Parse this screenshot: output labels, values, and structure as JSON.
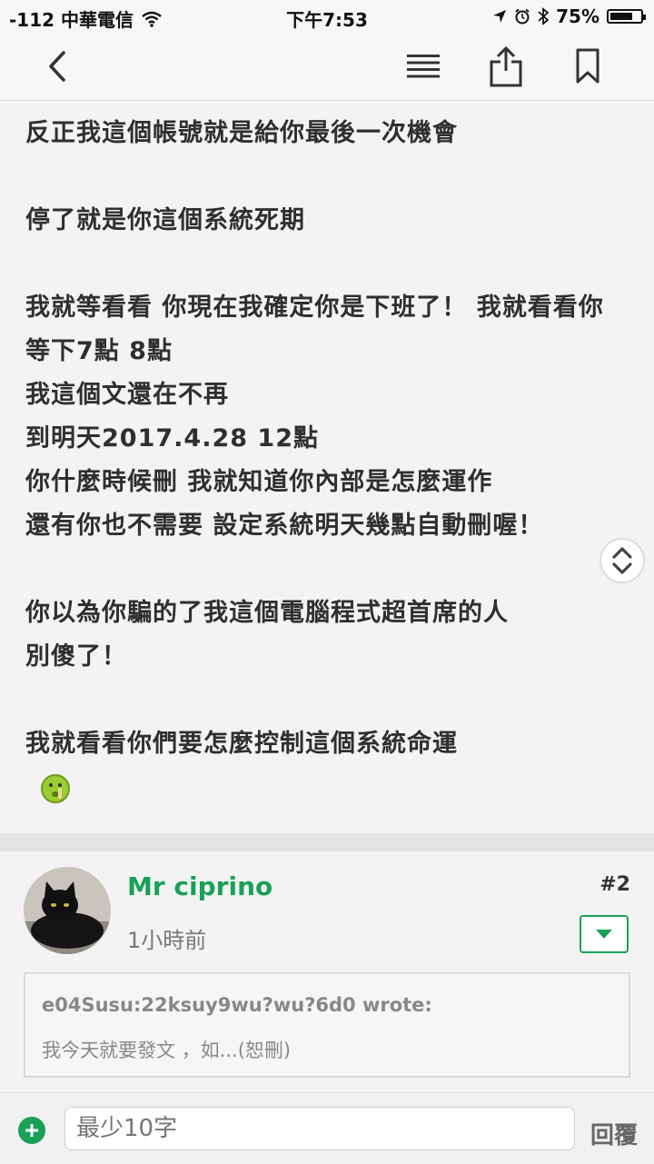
{
  "status_bar": {
    "carrier": "-112 中華電信",
    "time": "下午7:53",
    "battery": "75%",
    "battery_level": 0.75
  },
  "nav": {
    "back_icon": "chevron-left-icon",
    "menu_icon": "hamburger-menu-icon",
    "share_icon": "share-icon",
    "bookmark_icon": "bookmark-icon"
  },
  "post": {
    "lines": [
      "反正我這個帳號就是給你最後一次機會",
      "",
      "停了就是你這個系統死期",
      "",
      "我就等看看 你現在我確定你是下班了！ 我就看看你",
      "等下7點 8點",
      "我這個文還在不再",
      "到明天2017.4.28 12點",
      "你什麼時候刪 我就知道你內部是怎麼運作",
      "還有你也不需要 設定系統明天幾點自動刪喔！",
      "",
      "你以為你騙的了我這個電腦程式超首席的人",
      "別傻了！",
      "",
      "我就看看你們要怎麼控制這個系統命運"
    ]
  },
  "reply": {
    "username": "Mr ciprino",
    "time": "1小時前",
    "floor": "#2",
    "quote_author": "e04Susu:22ksuy9wu?wu?6d0 wrote:",
    "quote_text": "我今天就要發文 ，如...(恕刪)"
  },
  "composer": {
    "placeholder": "最少10字",
    "reply_label": "回覆"
  },
  "colors": {
    "accent": "#1aa057",
    "background": "#f3f3f3"
  }
}
